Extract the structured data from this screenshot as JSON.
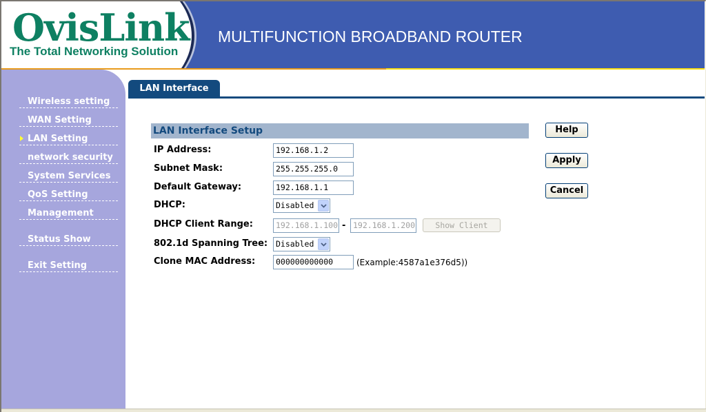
{
  "header": {
    "brand": "OvisLink",
    "tagline": "The Total Networking Solution",
    "title": "MULTIFUNCTION BROADBAND ROUTER"
  },
  "sidebar": {
    "items": [
      {
        "label": "Wireless setting",
        "active": false
      },
      {
        "label": "WAN Setting",
        "active": false
      },
      {
        "label": "LAN Setting",
        "active": true
      },
      {
        "label": "network security",
        "active": false
      },
      {
        "label": "System Services",
        "active": false
      },
      {
        "label": "QoS Setting",
        "active": false
      },
      {
        "label": "Management",
        "active": false
      },
      {
        "label": "Status Show",
        "active": false
      },
      {
        "label": "Exit Setting",
        "active": false
      }
    ]
  },
  "tab": {
    "label": "LAN Interface"
  },
  "form": {
    "section_title": "LAN Interface Setup",
    "ip_address": {
      "label": "IP Address:",
      "value": "192.168.1.2"
    },
    "subnet_mask": {
      "label": "Subnet Mask:",
      "value": "255.255.255.0"
    },
    "default_gateway": {
      "label": "Default Gateway:",
      "value": "192.168.1.1"
    },
    "dhcp": {
      "label": "DHCP:",
      "value": "Disabled"
    },
    "dhcp_range": {
      "label": "DHCP Client Range:",
      "start": "192.168.1.100",
      "separator": "-",
      "end": "192.168.1.200",
      "show_client": "Show Client"
    },
    "spanning_tree": {
      "label": "802.1d Spanning Tree:",
      "value": "Disabled"
    },
    "clone_mac": {
      "label": "Clone MAC Address:",
      "value": "000000000000",
      "example": "(Example:4587a1e376d5))"
    }
  },
  "buttons": {
    "help": "Help",
    "apply": "Apply",
    "cancel": "Cancel"
  },
  "colors": {
    "header_blue": "#3e5cb0",
    "brand_green": "#0e8062",
    "sidebar": "#a6a6dd",
    "tab_navy": "#134a7e",
    "section_bg": "#a2b5cd"
  }
}
